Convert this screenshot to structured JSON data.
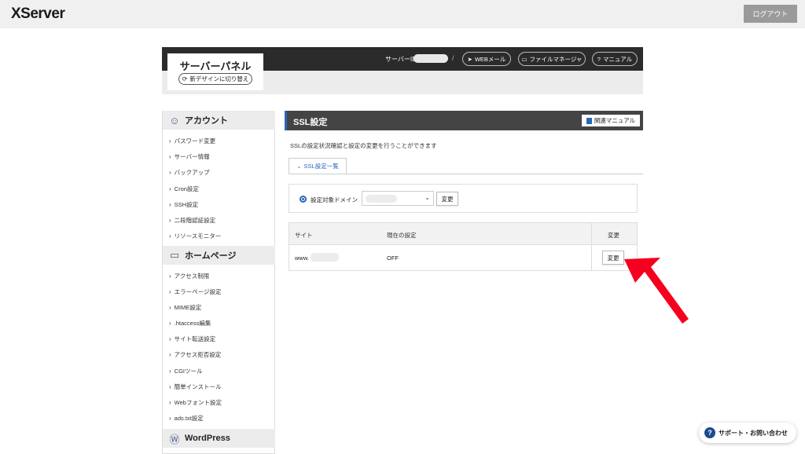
{
  "header": {
    "logo": "XServer",
    "logout_label": "ログアウト"
  },
  "panel": {
    "title": "サーバーパネル",
    "new_design_label": "新デザインに切り替え",
    "server_id_label": "サーバーID",
    "separator": "/",
    "webmail_label": "WEBメール",
    "file_manager_label": "ファイルマネージャ",
    "manual_label": "マニュアル"
  },
  "sidebar": {
    "sections": [
      {
        "title": "アカウント",
        "icon": "user-icon",
        "items": [
          "パスワード変更",
          "サーバー情報",
          "バックアップ",
          "Cron設定",
          "SSH設定",
          "二段階認証設定",
          "リソースモニター"
        ]
      },
      {
        "title": "ホームページ",
        "icon": "window-icon",
        "items": [
          "アクセス制限",
          "エラーページ設定",
          "MIME設定",
          ".htaccess編集",
          "サイト転送設定",
          "アクセス拒否設定",
          "CGIツール",
          "簡単インストール",
          "Webフォント設定",
          "ads.txt設定"
        ]
      },
      {
        "title": "WordPress",
        "icon": "wordpress-icon",
        "items": []
      }
    ]
  },
  "main": {
    "title": "SSL設定",
    "related_manual_label": "関連マニュアル",
    "description": "SSLの設定状況確認と設定の変更を行うことができます",
    "tab_label": "SSL設定一覧",
    "domain_label": "設定対象ドメイン",
    "domain_change_label": "変更",
    "table": {
      "columns": [
        "サイト",
        "現在の設定",
        "変更"
      ],
      "rows": [
        {
          "site": "www.",
          "status": "OFF",
          "action": "変更"
        }
      ]
    }
  },
  "support": {
    "label": "サポート・お問い合わせ",
    "icon_text": "?"
  },
  "colors": {
    "accent": "#2a66b8",
    "arrow": "#f5001e",
    "dark_bar": "#2b2b2b"
  }
}
